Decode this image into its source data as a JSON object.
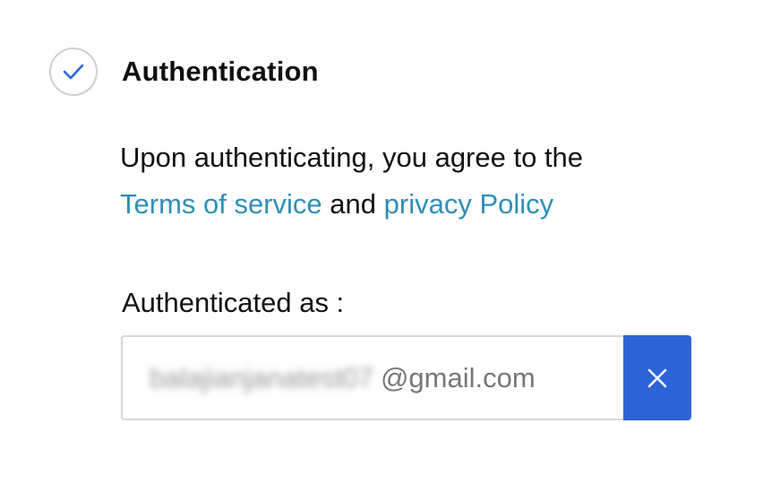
{
  "step": {
    "title": "Authentication",
    "status_icon": "check-icon",
    "check_color": "#2c64d8"
  },
  "agreement": {
    "line1": "Upon authenticating, you agree to the",
    "terms_link": "Terms of service",
    "conjunction": "and",
    "privacy_link": "privacy Policy",
    "link_color": "#2f8fb8"
  },
  "account": {
    "label": "Authenticated as :",
    "email_user": "balajianjanatest07",
    "email_domain": "@gmail.com",
    "remove_icon": "close-icon",
    "button_color": "#2c64d8"
  }
}
